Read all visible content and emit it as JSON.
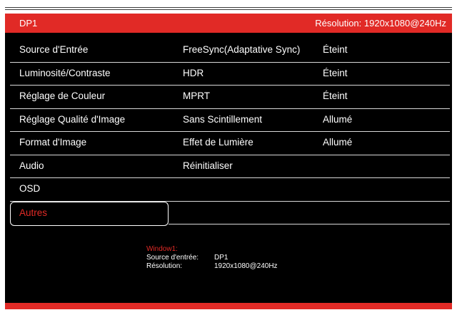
{
  "header": {
    "input_name": "DP1",
    "resolution": "Résolution: 1920x1080@240Hz"
  },
  "menu": {
    "items": [
      {
        "label": "Source d'Entrée"
      },
      {
        "label": "Luminosité/Contraste"
      },
      {
        "label": "Réglage de Couleur"
      },
      {
        "label": "Réglage Qualité d'Image"
      },
      {
        "label": "Format d'Image"
      },
      {
        "label": "Audio"
      },
      {
        "label": "OSD"
      },
      {
        "label": "Autres"
      }
    ],
    "selected_label": "Autres"
  },
  "submenu": {
    "items": [
      {
        "label": "FreeSync(Adaptative Sync)",
        "value": "Éteint"
      },
      {
        "label": "HDR",
        "value": "Éteint"
      },
      {
        "label": "MPRT",
        "value": "Éteint"
      },
      {
        "label": "Sans Scintillement",
        "value": "Allumé"
      },
      {
        "label": "Effet de Lumière",
        "value": "Allumé"
      },
      {
        "label": "Réinitialiser",
        "value": ""
      }
    ]
  },
  "info": {
    "title": "Window1:",
    "source_label": "Source d'entrée:",
    "source_value": "DP1",
    "resolution_label": "Résolution:",
    "resolution_value": "1920x1080@240Hz"
  },
  "colors": {
    "accent": "#e12a26",
    "background": "#000000",
    "text": "#ffffff"
  }
}
